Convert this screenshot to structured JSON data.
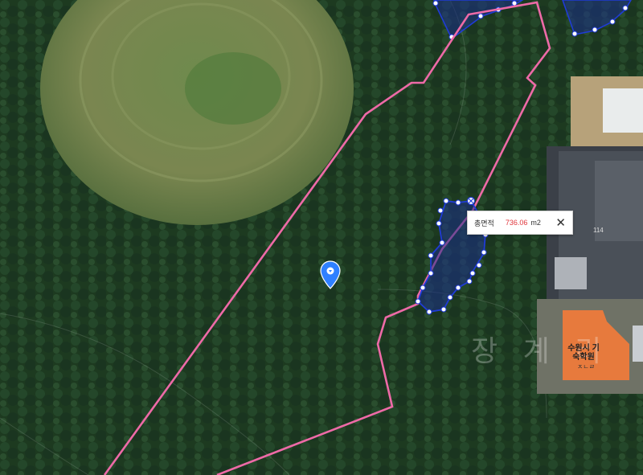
{
  "map": {
    "area_popup": {
      "label": "총면적",
      "value": "736.06",
      "unit": "m2",
      "close_icon": "close-icon"
    },
    "village_label": "장 계 리",
    "building_number": "114",
    "building_name": "수원시 기숙학원",
    "building_sub": "ㅈㄴㄹ",
    "pin_icon": "map-pin-icon",
    "colors": {
      "boundary": "#ee6aa7",
      "polygon_stroke": "#1f3bd6",
      "polygon_fill": "#1c2f8a",
      "vertex": "#ffffff",
      "orange_roof": "#e77a3d",
      "pin": "#2f80ff",
      "popup_value": "#e0353b"
    }
  }
}
